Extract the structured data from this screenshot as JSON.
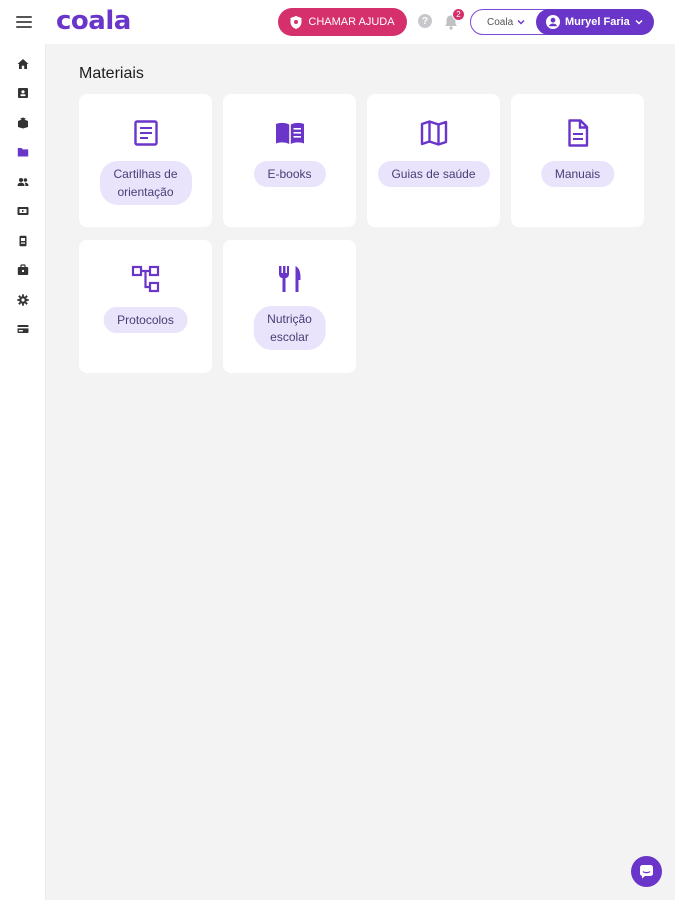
{
  "header": {
    "logo": "coala",
    "help_button": "CHAMAR AJUDA",
    "notification_count": "2",
    "org_select": "Coala",
    "user_name": "Muryel Faria"
  },
  "sidebar": {
    "items": [
      {
        "name": "home-icon"
      },
      {
        "name": "contact-card-icon"
      },
      {
        "name": "book-icon"
      },
      {
        "name": "folder-icon",
        "active": true
      },
      {
        "name": "people-icon"
      },
      {
        "name": "video-icon"
      },
      {
        "name": "badge-icon"
      },
      {
        "name": "briefcase-icon"
      },
      {
        "name": "gear-icon"
      },
      {
        "name": "card-icon"
      }
    ]
  },
  "main": {
    "title": "Materiais",
    "cards": [
      {
        "label_line1": "Cartilhas de",
        "label_line2": "orientação",
        "icon": "document-icon"
      },
      {
        "label": "E-books",
        "icon": "open-book-icon"
      },
      {
        "label": "Guias de saúde",
        "icon": "map-icon"
      },
      {
        "label": "Manuais",
        "icon": "file-icon"
      },
      {
        "label": "Protocolos",
        "icon": "flowchart-icon"
      },
      {
        "label_line1": "Nutrição",
        "label_line2": "escolar",
        "icon": "fork-knife-icon"
      }
    ]
  },
  "colors": {
    "brand": "#6a35c9",
    "help": "#d5306c",
    "pill_bg": "#e9e3fb",
    "background": "#f3f3f4"
  }
}
